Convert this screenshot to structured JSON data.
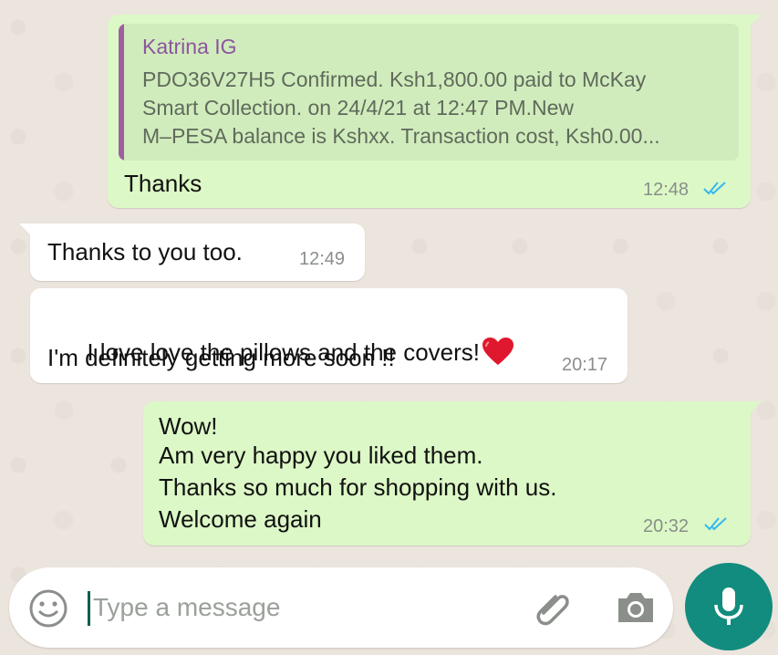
{
  "messages": [
    {
      "direction": "outgoing",
      "quote": {
        "author": "Katrina IG",
        "lines": [
          "PDO36V27H5 Confirmed. Ksh1,800.00 paid to McKay",
          "Smart Collection. on 24/4/21 at 12:47 PM.New",
          "M–PESA balance is Kshxx. Transaction cost, Ksh0.00..."
        ]
      },
      "text": "Thanks",
      "time": "12:48",
      "status": "read"
    },
    {
      "direction": "incoming",
      "text": "Thanks to you too.",
      "time": "12:49"
    },
    {
      "direction": "incoming",
      "lines": [
        "I love love the pillows and the covers!",
        "I'm definitely getting more soon !!"
      ],
      "emoji": "heart",
      "time": "20:17"
    },
    {
      "direction": "outgoing",
      "lines": [
        "Wow!",
        "Am very happy you liked them.",
        "Thanks so much for shopping with us.",
        "Welcome again"
      ],
      "time": "20:32",
      "status": "read"
    }
  ],
  "composer": {
    "placeholder": "Type a message",
    "value": "",
    "icons": [
      "emoji-icon",
      "attach-icon",
      "camera-icon",
      "mic-icon"
    ]
  },
  "colors": {
    "outgoing_bubble": "#dcf8c6",
    "incoming_bubble": "#ffffff",
    "read_ticks": "#34b7f1",
    "quote_bar": "#9d5fa2",
    "mic_button": "#128c7e"
  }
}
